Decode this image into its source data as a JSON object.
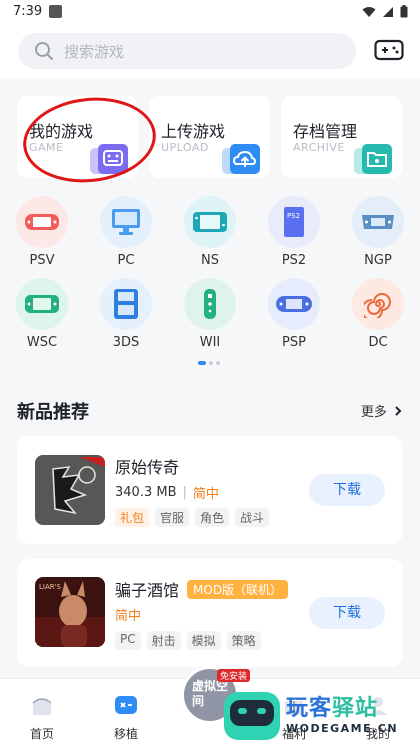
{
  "status_bar": {
    "time": "7:39"
  },
  "search": {
    "placeholder": "搜索游戏"
  },
  "quick_cards": [
    {
      "title": "我的游戏",
      "subtitle": "GAME",
      "color": "#7b6cf0"
    },
    {
      "title": "上传游戏",
      "subtitle": "UPLOAD",
      "color": "#2f8cf5"
    },
    {
      "title": "存档管理",
      "subtitle": "ARCHIVE",
      "color": "#26b9b0"
    }
  ],
  "platforms": [
    {
      "label": "PSV",
      "icon": "psv-handheld-icon"
    },
    {
      "label": "PC",
      "icon": "monitor-icon"
    },
    {
      "label": "NS",
      "icon": "switch-console-icon"
    },
    {
      "label": "PS2",
      "icon": "ps2-console-icon"
    },
    {
      "label": "NGP",
      "icon": "ngp-handheld-icon"
    },
    {
      "label": "WSC",
      "icon": "wsc-handheld-icon"
    },
    {
      "label": "3DS",
      "icon": "3ds-handheld-icon"
    },
    {
      "label": "WII",
      "icon": "wii-remote-icon"
    },
    {
      "label": "PSP",
      "icon": "psp-handheld-icon"
    },
    {
      "label": "DC",
      "icon": "dreamcast-swirl-icon"
    }
  ],
  "section": {
    "title": "新品推荐",
    "more": "更多"
  },
  "games": [
    {
      "name": "原始传奇",
      "size": "340.3 MB",
      "lang": "简中",
      "badge": "",
      "tags": [
        "礼包",
        "官服",
        "角色",
        "战斗"
      ],
      "download": "下载"
    },
    {
      "name": "骗子酒馆",
      "size": "",
      "lang": "简中",
      "badge": "MOD版（联机）",
      "tags": [
        "PC",
        "射击",
        "模拟",
        "策略"
      ],
      "download": "下载"
    }
  ],
  "bottom_nav": [
    {
      "label": "首页"
    },
    {
      "label": "移植"
    },
    {
      "label": "福利"
    },
    {
      "label": "我的"
    }
  ],
  "center_button": {
    "text": "虚拟空间",
    "tag": "免安装"
  },
  "watermark": {
    "brand_a": "玩客",
    "brand_b": "驿站",
    "url": "WODEGAME.CN"
  }
}
